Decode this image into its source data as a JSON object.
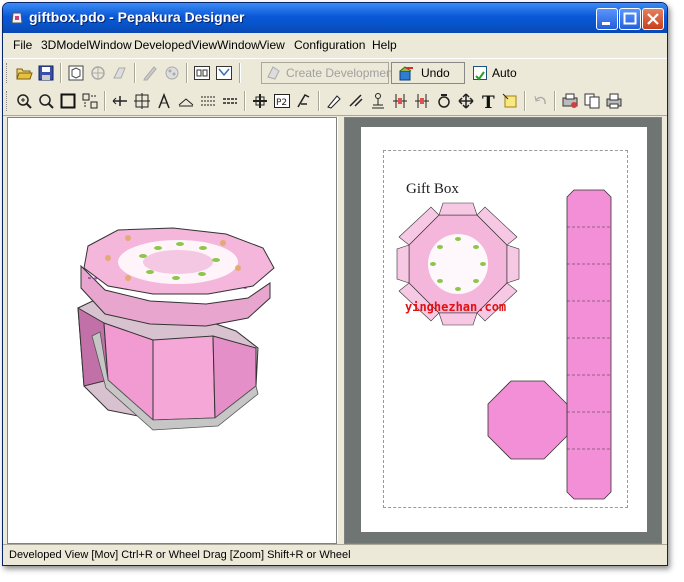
{
  "window": {
    "title": "giftbox.pdo - Pepakura Designer"
  },
  "menu": {
    "items": [
      "File",
      "3DModelWindow",
      "DevelopedViewWindow",
      "View",
      "Configuration",
      "Help"
    ]
  },
  "toolbar": {
    "create_label": "Create Development",
    "undo_label": "Undo",
    "auto_label": "Auto",
    "auto_checked": true
  },
  "developed_view": {
    "part_label": "Gift Box"
  },
  "status": {
    "text": "Developed View [Mov] Ctrl+R or Wheel Drag [Zoom] Shift+R or Wheel"
  },
  "watermarks": {
    "site": "yinghezhan.com"
  },
  "colors": {
    "title_blue": "#0a58d8",
    "part_pink": "#f28fd6",
    "lid_pink": "#f4b6da",
    "pane_gray": "#6f7572"
  },
  "icons": {
    "toolbar_1": [
      "open-folder-icon",
      "save-icon",
      "view-3d-icon",
      "unfold-icon",
      "arrange-icon",
      "edit-icon",
      "paint-icon",
      "page-icon",
      "layout-icon",
      "create-development-icon",
      "undo-icon"
    ],
    "toolbar_2": [
      "rotate-icon",
      "zoom-icon",
      "frame-icon",
      "fit-icon",
      "move-icon",
      "join-icon",
      "cut-icon",
      "fold-icon",
      "line-icon",
      "flap-icon",
      "part-icon",
      "text-icon",
      "pen-icon",
      "paint-brush-icon",
      "scale-icon",
      "align-icon",
      "distribute-icon",
      "rotate-part-icon",
      "center-icon",
      "text-tool-icon",
      "image-icon",
      "undo-small-icon",
      "print-setup-icon",
      "copy-icon",
      "print-icon"
    ]
  }
}
